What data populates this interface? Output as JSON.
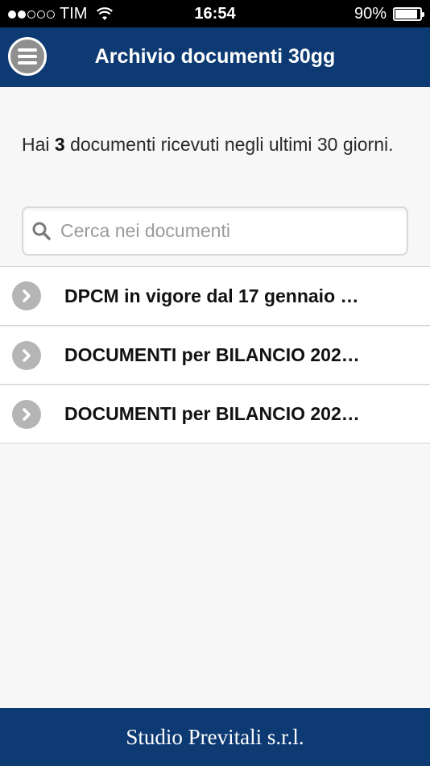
{
  "status_bar": {
    "carrier": "TIM",
    "time": "16:54",
    "battery_percent": "90%",
    "battery_level": 0.9,
    "signal_bars_filled": 2,
    "signal_bars_total": 5
  },
  "header": {
    "title": "Archivio documenti 30gg",
    "menu_icon": "hamburger-menu-icon",
    "color": "#0d3a73"
  },
  "summary": {
    "prefix": "Hai",
    "count": "3",
    "suffix": "documenti ricevuti negli ultimi 30 giorni."
  },
  "search": {
    "placeholder": "Cerca nei documenti",
    "value": "",
    "icon": "search-icon"
  },
  "documents": [
    {
      "label": "DPCM in vigore dal 17 gennaio …"
    },
    {
      "label": "DOCUMENTI per BILANCIO 202…"
    },
    {
      "label": "DOCUMENTI per BILANCIO 202…"
    }
  ],
  "footer": {
    "text": "Studio Previtali s.r.l."
  }
}
